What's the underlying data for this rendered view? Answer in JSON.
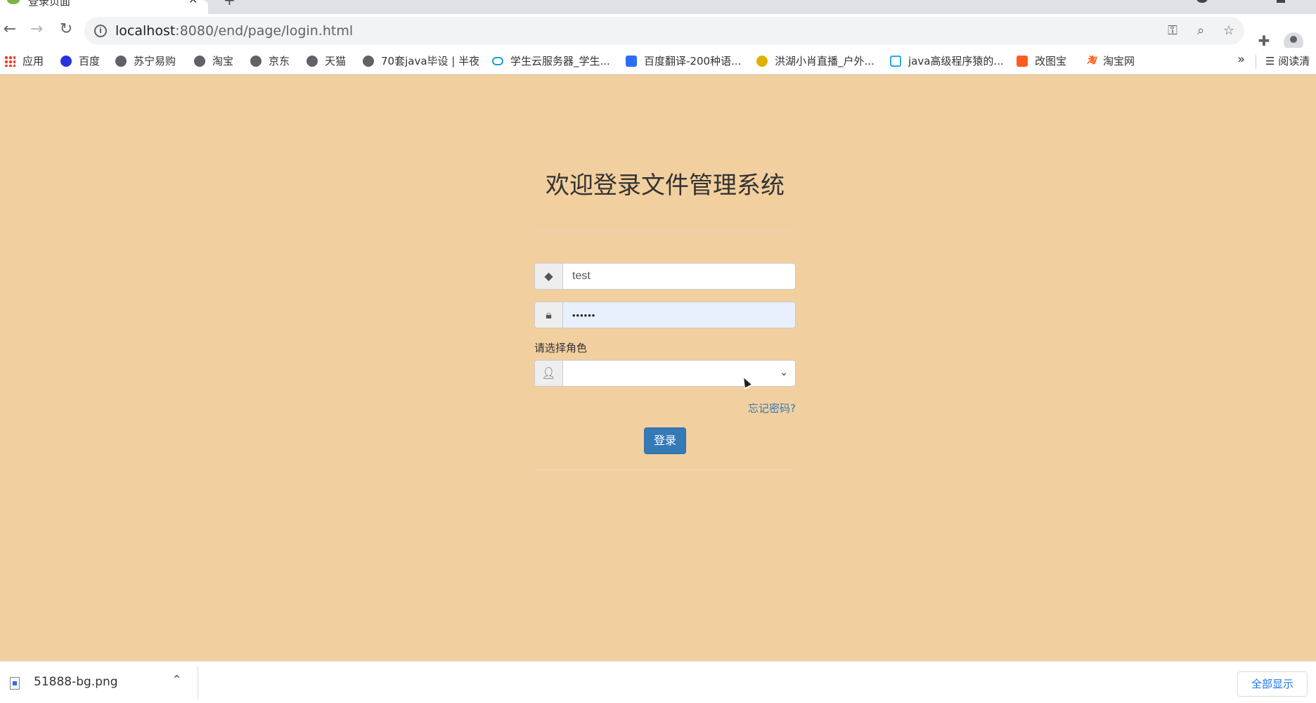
{
  "browser": {
    "tab_title": "登录页面",
    "tab_close": "✕",
    "new_tab": "+",
    "url_host": "localhost",
    "url_rest": ":8080/end/page/login.html",
    "bookmarks": [
      {
        "label": "应用",
        "icon": "apps-grid-icon"
      },
      {
        "label": "百度",
        "icon": "baidu-icon"
      },
      {
        "label": "苏宁易购",
        "icon": "globe-icon"
      },
      {
        "label": "淘宝",
        "icon": "globe-icon"
      },
      {
        "label": "京东",
        "icon": "globe-icon"
      },
      {
        "label": "天猫",
        "icon": "globe-icon"
      },
      {
        "label": "70套java毕设 | 半夜",
        "icon": "globe-icon"
      },
      {
        "label": "学生云服务器_学生...",
        "icon": "cloud-icon"
      },
      {
        "label": "百度翻译-200种语...",
        "icon": "fanyi-icon"
      },
      {
        "label": "洪湖小肖直播_户外...",
        "icon": "live-icon"
      },
      {
        "label": "java高级程序猿的...",
        "icon": "bilibili-icon"
      },
      {
        "label": "改图宝",
        "icon": "gaitubao-icon"
      },
      {
        "label": "淘宝网",
        "icon": "taobao-icon"
      }
    ],
    "bookmarks_more": "»",
    "reading_list": "阅读清"
  },
  "login": {
    "title": "欢迎登录文件管理系统",
    "username_value": "test",
    "password_value": "••••••",
    "role_label": "请选择角色",
    "role_selected": "",
    "forgot_link": "忘记密码?",
    "submit_label": "登录"
  },
  "downloads": {
    "file_name": "51888-bg.png",
    "show_all": "全部显示"
  },
  "colors": {
    "page_background": "#f2cf9f",
    "primary_button": "#337ab7",
    "link": "#337ab7"
  }
}
